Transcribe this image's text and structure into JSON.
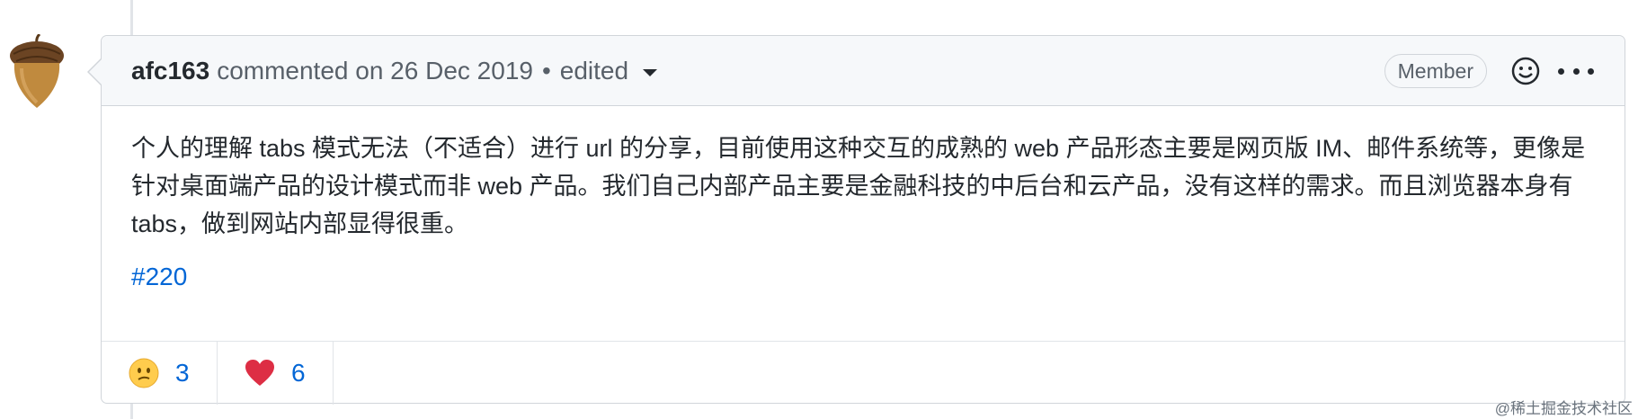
{
  "comment": {
    "author": "afc163",
    "action": "commented on 26 Dec 2019",
    "separator": "•",
    "edited": "edited",
    "badge": "Member",
    "body": "个人的理解 tabs 模式无法（不适合）进行 url 的分享，目前使用这种交互的成熟的 web 产品形态主要是网页版 IM、邮件系统等，更像是针对桌面端产品的设计模式而非 web 产品。我们自己内部产品主要是金融科技的中后台和云产品，没有这样的需求。而且浏览器本身有 tabs，做到网站内部显得很重。",
    "link": "#220",
    "reactions": [
      {
        "icon": "confused-face-icon",
        "count": "3"
      },
      {
        "icon": "heart-icon",
        "count": "6"
      }
    ]
  },
  "watermark": "@稀土掘金技术社区",
  "colors": {
    "header_bg": "#f6f8fa",
    "border": "#d1d5da",
    "link": "#0366d6",
    "text": "#24292e",
    "muted": "#586069"
  }
}
